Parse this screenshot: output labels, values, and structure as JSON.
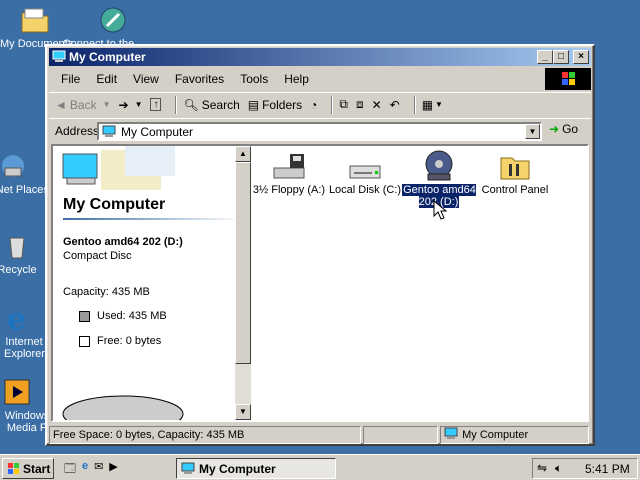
{
  "desktop": {
    "icons": [
      {
        "label": "My Documents"
      },
      {
        "label": "Connect to the..."
      },
      {
        "label": "My Net Places"
      },
      {
        "label": "Recycle"
      },
      {
        "label": "Internet Explorer"
      },
      {
        "label": "Windows Media P"
      }
    ]
  },
  "window": {
    "title": "My Computer",
    "menu": [
      "File",
      "Edit",
      "View",
      "Favorites",
      "Tools",
      "Help"
    ],
    "toolbar": {
      "back": "Back",
      "search": "Search",
      "folders": "Folders"
    },
    "address": {
      "label": "Address",
      "value": "My Computer",
      "go": "Go"
    },
    "left_pane": {
      "title": "My Computer",
      "drive_name": "Gentoo amd64 202 (D:)",
      "drive_type": "Compact Disc",
      "capacity": "Capacity: 435 MB",
      "used": "Used: 435 MB",
      "free": "Free: 0 bytes",
      "used_fraction": 1.0
    },
    "items": [
      {
        "label": "3½ Floppy (A:)",
        "icon": "floppy-drive-icon"
      },
      {
        "label": "Local Disk (C:)",
        "icon": "hard-disk-icon"
      },
      {
        "label": "Gentoo amd64 202 (D:)",
        "icon": "cd-drive-icon",
        "selected": true
      },
      {
        "label": "Control Panel",
        "icon": "control-panel-icon"
      }
    ],
    "status": {
      "left": "Free Space: 0 bytes, Capacity: 435 MB",
      "right": "My Computer"
    }
  },
  "taskbar": {
    "start": "Start",
    "task": "My Computer",
    "clock": "5:41 PM"
  },
  "colors": {
    "desktop": "#3a6ea5",
    "title_active": "#0a246a",
    "face": "#d4d0c8"
  }
}
